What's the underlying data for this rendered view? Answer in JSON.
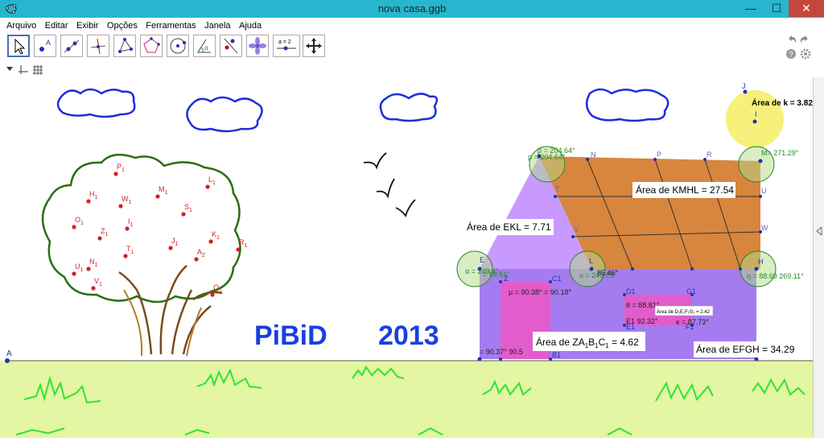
{
  "window": {
    "title": "nova casa.ggb",
    "minimize": "—",
    "maximize": "☐",
    "close": "✕"
  },
  "menu": [
    "Arquivo",
    "Editar",
    "Exibir",
    "Opções",
    "Ferramentas",
    "Janela",
    "Ajuda"
  ],
  "toolbar": {
    "tools": [
      "move-tool",
      "point-tool",
      "line-tool",
      "perpendicular-line-tool",
      "polygon-tool",
      "regular-polygon-tool",
      "circle-tool",
      "angle-tool",
      "reflect-tool",
      "transform-tool",
      "slider-tool",
      "move-graphics-tool"
    ],
    "slider_label": "a = 2"
  },
  "canvas": {
    "title_left": "PiBiD",
    "title_right": "2013",
    "point_A": "A",
    "tree_points": [
      "P1",
      "L1",
      "M1",
      "H1",
      "W1",
      "S1",
      "O1",
      "I1",
      "Z1",
      "K1",
      "R1",
      "T1",
      "J1",
      "A2",
      "U1",
      "N1",
      "V1",
      "Q1"
    ],
    "area_sun": "Área de k = 3.82",
    "sun_point_J": "J",
    "sun_point_I": "I",
    "area_roof": "Área de  KMHL = 27.54",
    "area_ekl": "Área de  EKL = 7.71",
    "area_zab": "Área de  ZA",
    "area_zab_tail": "B",
    "area_zab_tail2": "C",
    "area_zab_value": " = 4.62",
    "area_efgh": "Área de  EFGH = 34.29",
    "area_small": "Área de  D₁E₁F₁G₁ = 2.42",
    "angles": {
      "beta": "β = 204.64°",
      "rho": "ρ = 204.64°",
      "M_angle": "M= 271.29°",
      "alpha": "α = 249.4°",
      "gamma": "= 89.51°",
      "mu": "μ = 90.38° = 90.18°",
      "upsilon": "υ = 249.73°",
      "eta": "η = 88.69 269.11°",
      "theta": "θ = 88.81°",
      "e1": "E1 92.32°",
      "kappa": "κ = 87.73°",
      "bottom": "= 90.37° 90.5",
      "val_t": "85.46°"
    },
    "house_labels": [
      "N",
      "P",
      "R",
      "T",
      "U",
      "V",
      "W",
      "E",
      "L",
      "H",
      "C1",
      "Z",
      "D1",
      "G1",
      "F1",
      "B1",
      "E1"
    ]
  },
  "colors": {
    "titlebar": "#26b7cf",
    "cloud": "#1b2fd9",
    "sun": "#f7f07a",
    "roof": "#d8853e",
    "gable": "#c89aff",
    "wall": "#a47cf0",
    "door": "#e25ccb",
    "grass_bg": "#e4f5a4",
    "grass": "#2ee52e",
    "tree_outline": "#2a6e16",
    "trunk": "#7b4a1e",
    "point": "#d62020",
    "pibid": "#1a3fe0"
  }
}
